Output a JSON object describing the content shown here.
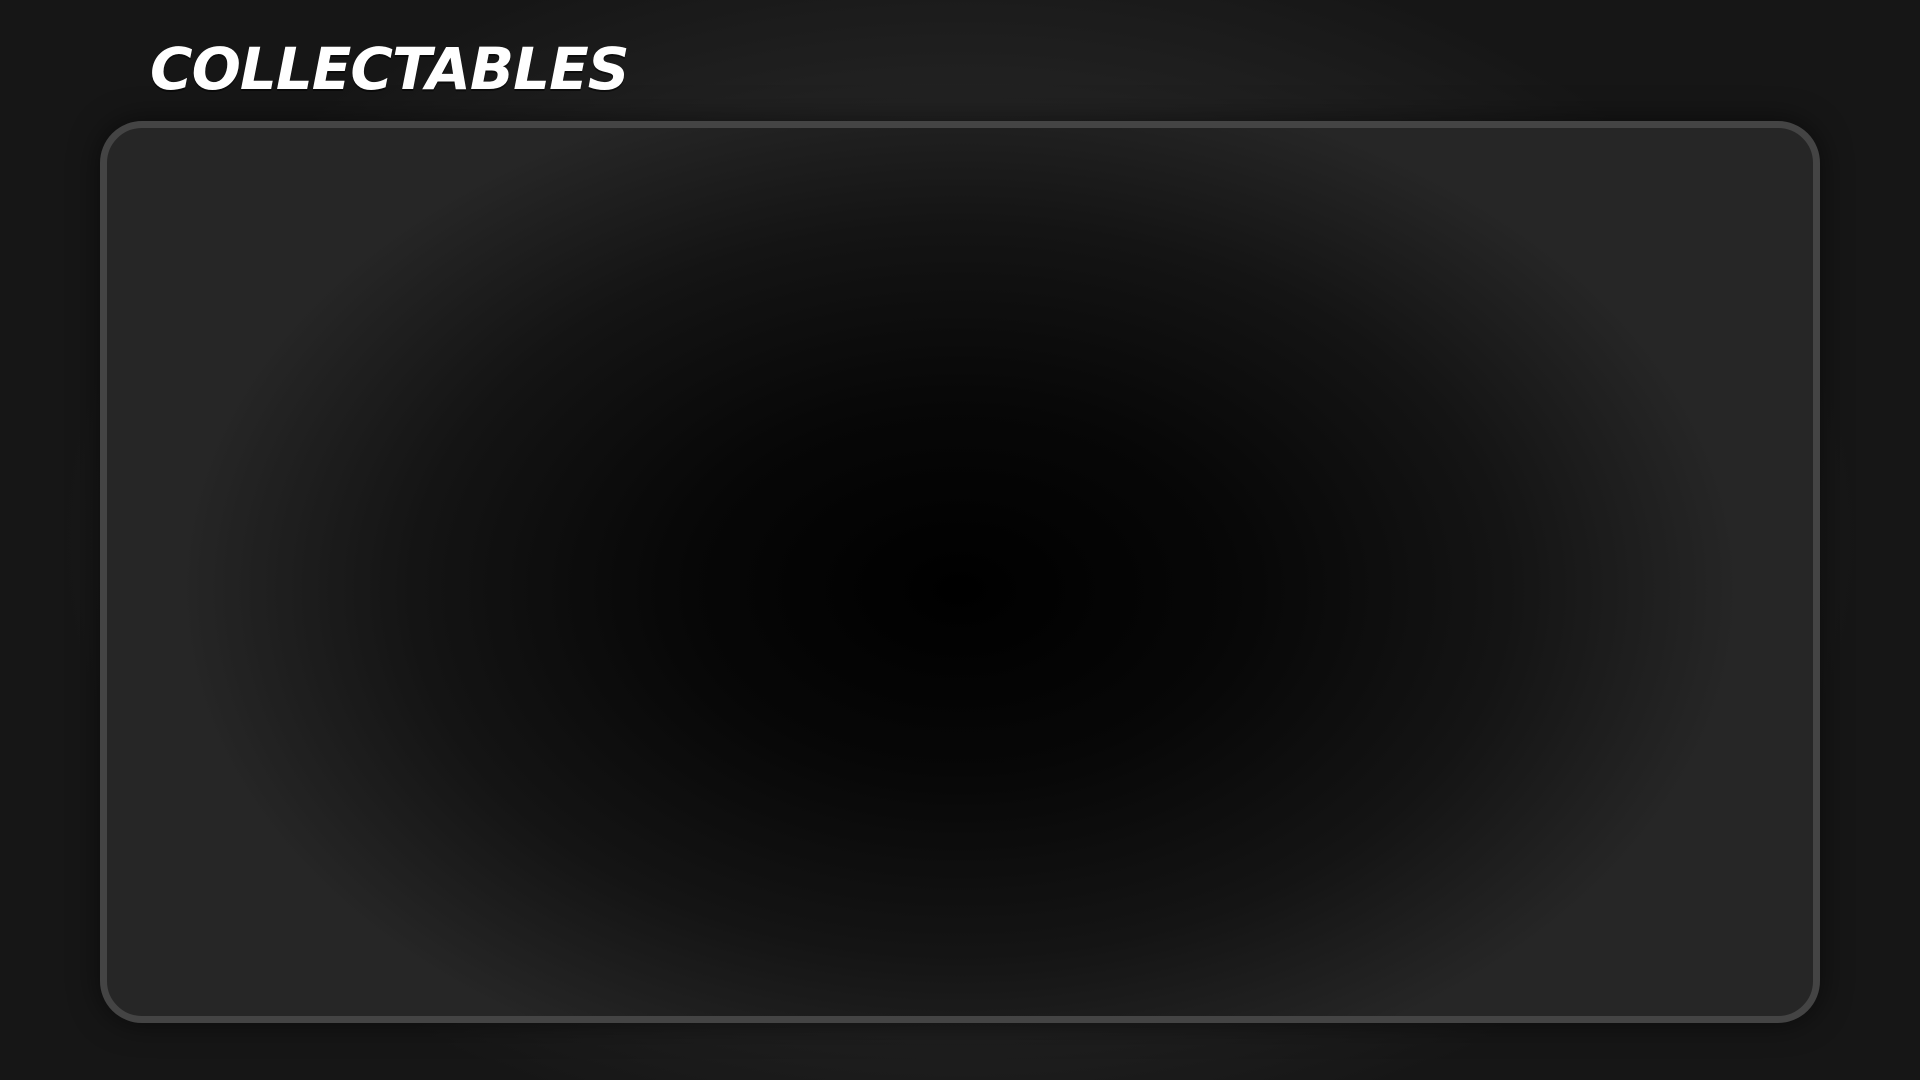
{
  "header": {
    "title": "Collectables"
  },
  "colors": {
    "background": "#2c2c2c",
    "panel_border": "#444444",
    "panel_fill": "#000000",
    "title_text": "#ffffff"
  }
}
